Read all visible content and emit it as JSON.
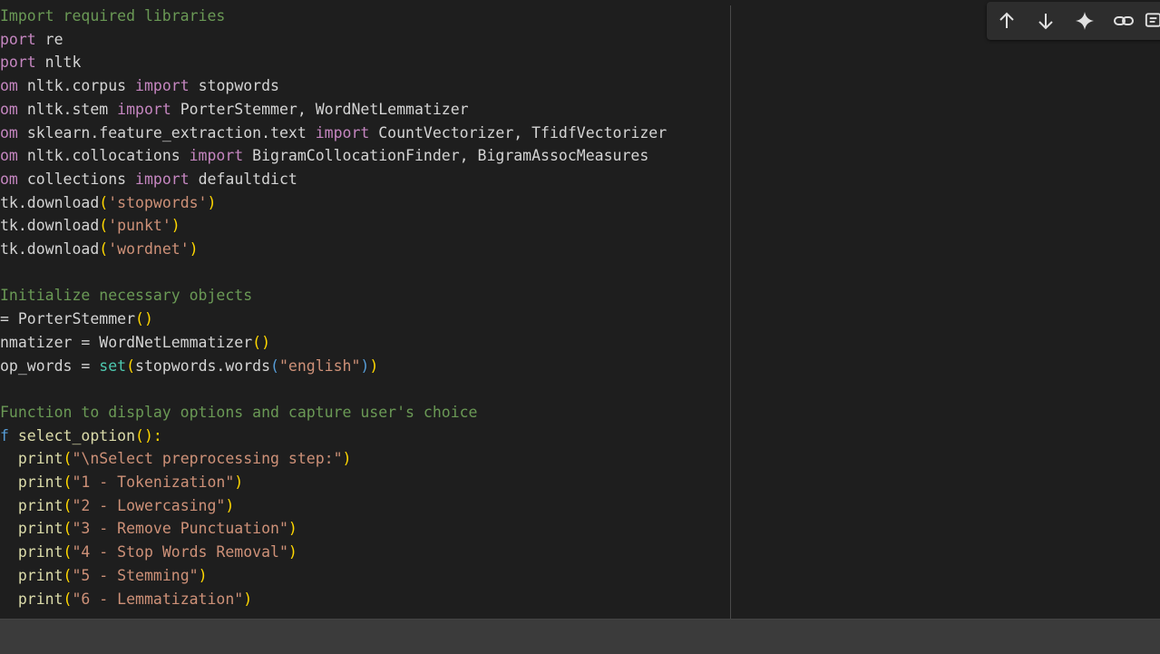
{
  "toolbar": {
    "buttons": [
      {
        "name": "move-up-button",
        "icon": "arrow-up-icon"
      },
      {
        "name": "move-down-button",
        "icon": "arrow-down-icon"
      },
      {
        "name": "ai-sparkle-button",
        "icon": "sparkle-icon"
      },
      {
        "name": "link-button",
        "icon": "link-icon"
      },
      {
        "name": "more-button",
        "icon": "comment-icon"
      }
    ]
  },
  "code_lines": [
    [
      {
        "t": "Import required libraries",
        "c": "com"
      }
    ],
    [
      {
        "t": "port ",
        "c": "kw"
      },
      {
        "t": "re",
        "c": "plain"
      }
    ],
    [
      {
        "t": "port ",
        "c": "kw"
      },
      {
        "t": "nltk",
        "c": "plain"
      }
    ],
    [
      {
        "t": "om ",
        "c": "kw"
      },
      {
        "t": "nltk.corpus ",
        "c": "plain"
      },
      {
        "t": "import ",
        "c": "kw"
      },
      {
        "t": "stopwords",
        "c": "plain"
      }
    ],
    [
      {
        "t": "om ",
        "c": "kw"
      },
      {
        "t": "nltk.stem ",
        "c": "plain"
      },
      {
        "t": "import ",
        "c": "kw"
      },
      {
        "t": "PorterStemmer, WordNetLemmatizer",
        "c": "plain"
      }
    ],
    [
      {
        "t": "om ",
        "c": "kw"
      },
      {
        "t": "sklearn.feature_extraction.text ",
        "c": "plain"
      },
      {
        "t": "import ",
        "c": "kw"
      },
      {
        "t": "CountVectorizer, TfidfVectorizer",
        "c": "plain"
      }
    ],
    [
      {
        "t": "om ",
        "c": "kw"
      },
      {
        "t": "nltk.collocations ",
        "c": "plain"
      },
      {
        "t": "import ",
        "c": "kw"
      },
      {
        "t": "BigramCollocationFinder, BigramAssocMeasures",
        "c": "plain"
      }
    ],
    [
      {
        "t": "om ",
        "c": "kw"
      },
      {
        "t": "collections ",
        "c": "plain"
      },
      {
        "t": "import ",
        "c": "kw"
      },
      {
        "t": "defaultdict",
        "c": "plain"
      }
    ],
    [
      {
        "t": "tk.download",
        "c": "plain"
      },
      {
        "t": "(",
        "c": "br"
      },
      {
        "t": "'stopwords'",
        "c": "str"
      },
      {
        "t": ")",
        "c": "br"
      }
    ],
    [
      {
        "t": "tk.download",
        "c": "plain"
      },
      {
        "t": "(",
        "c": "br"
      },
      {
        "t": "'punkt'",
        "c": "str"
      },
      {
        "t": ")",
        "c": "br"
      }
    ],
    [
      {
        "t": "tk.download",
        "c": "plain"
      },
      {
        "t": "(",
        "c": "br"
      },
      {
        "t": "'wordnet'",
        "c": "str"
      },
      {
        "t": ")",
        "c": "br"
      }
    ],
    [],
    [
      {
        "t": "Initialize necessary objects",
        "c": "com"
      }
    ],
    [
      {
        "t": "= PorterStemmer",
        "c": "plain"
      },
      {
        "t": "()",
        "c": "br"
      }
    ],
    [
      {
        "t": "nmatizer = WordNetLemmatizer",
        "c": "plain"
      },
      {
        "t": "()",
        "c": "br"
      }
    ],
    [
      {
        "t": "op_words = ",
        "c": "plain"
      },
      {
        "t": "set",
        "c": "bi"
      },
      {
        "t": "(",
        "c": "br"
      },
      {
        "t": "stopwords.words",
        "c": "plain"
      },
      {
        "t": "(",
        "c": "def"
      },
      {
        "t": "\"english\"",
        "c": "str"
      },
      {
        "t": ")",
        "c": "def"
      },
      {
        "t": ")",
        "c": "br"
      }
    ],
    [],
    [
      {
        "t": "Function to display options and capture user's choice",
        "c": "com"
      }
    ],
    [
      {
        "t": "f ",
        "c": "def"
      },
      {
        "t": "select_option",
        "c": "fn"
      },
      {
        "t": "():",
        "c": "br"
      }
    ],
    [
      {
        "t": "  print",
        "c": "fn"
      },
      {
        "t": "(",
        "c": "br"
      },
      {
        "t": "\"\\nSelect preprocessing step:\"",
        "c": "str"
      },
      {
        "t": ")",
        "c": "br"
      }
    ],
    [
      {
        "t": "  print",
        "c": "fn"
      },
      {
        "t": "(",
        "c": "br"
      },
      {
        "t": "\"1 - Tokenization\"",
        "c": "str"
      },
      {
        "t": ")",
        "c": "br"
      }
    ],
    [
      {
        "t": "  print",
        "c": "fn"
      },
      {
        "t": "(",
        "c": "br"
      },
      {
        "t": "\"2 - Lowercasing\"",
        "c": "str"
      },
      {
        "t": ")",
        "c": "br"
      }
    ],
    [
      {
        "t": "  print",
        "c": "fn"
      },
      {
        "t": "(",
        "c": "br"
      },
      {
        "t": "\"3 - Remove Punctuation\"",
        "c": "str"
      },
      {
        "t": ")",
        "c": "br"
      }
    ],
    [
      {
        "t": "  print",
        "c": "fn"
      },
      {
        "t": "(",
        "c": "br"
      },
      {
        "t": "\"4 - Stop Words Removal\"",
        "c": "str"
      },
      {
        "t": ")",
        "c": "br"
      }
    ],
    [
      {
        "t": "  print",
        "c": "fn"
      },
      {
        "t": "(",
        "c": "br"
      },
      {
        "t": "\"5 - Stemming\"",
        "c": "str"
      },
      {
        "t": ")",
        "c": "br"
      }
    ],
    [
      {
        "t": "  print",
        "c": "fn"
      },
      {
        "t": "(",
        "c": "br"
      },
      {
        "t": "\"6 - Lemmatization\"",
        "c": "str"
      },
      {
        "t": ")",
        "c": "br"
      }
    ]
  ],
  "colors": {
    "background": "#1e1e1e",
    "comment": "#6a9955",
    "keyword": "#c586c0",
    "function": "#dcdcaa",
    "string": "#ce9178",
    "bracket": "#ffd700",
    "builtin": "#4ec9b0"
  }
}
